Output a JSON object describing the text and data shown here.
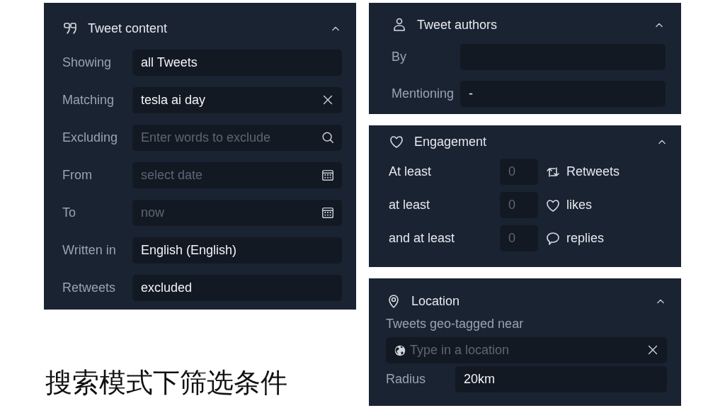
{
  "tweet_content": {
    "title": "Tweet content",
    "rows": [
      {
        "kind": "text",
        "label": "Showing",
        "value": "all Tweets"
      },
      {
        "kind": "clearable",
        "label": "Matching",
        "value": "tesla ai day"
      },
      {
        "kind": "search",
        "label": "Excluding",
        "placeholder": "Enter words to exclude"
      },
      {
        "kind": "date",
        "label": "From",
        "placeholder": "select date"
      },
      {
        "kind": "date",
        "label": "To",
        "placeholder": "now"
      },
      {
        "kind": "text",
        "label": "Written in",
        "value": "English (English)"
      },
      {
        "kind": "text",
        "label": "Retweets",
        "value": "excluded"
      }
    ]
  },
  "tweet_authors": {
    "title": "Tweet authors",
    "rows": [
      {
        "label": "By"
      },
      {
        "label": "Mentioning",
        "value": "-"
      }
    ]
  },
  "engagement": {
    "title": "Engagement",
    "rows": [
      {
        "label": "At least",
        "placeholder": "0",
        "metric": "Retweets"
      },
      {
        "label": "at least",
        "placeholder": "0",
        "metric": "likes"
      },
      {
        "label": "and at least",
        "placeholder": "0",
        "metric": "replies"
      }
    ]
  },
  "location": {
    "title": "Location",
    "label": "Tweets geo-tagged near",
    "field": {
      "kind": "clearable",
      "placeholder": "Type in a location"
    },
    "radius": {
      "label": "Radius",
      "value": "20km"
    }
  },
  "caption": "搜索模式下筛选条件"
}
